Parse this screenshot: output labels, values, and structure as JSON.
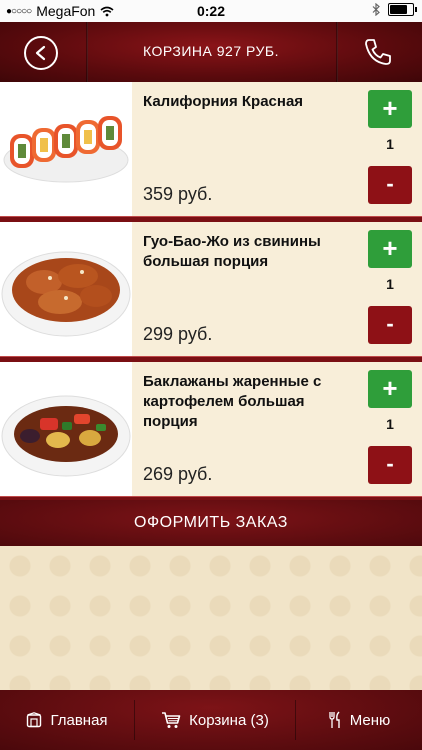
{
  "status_bar": {
    "carrier": "MegaFon",
    "time": "0:22",
    "battery_level": 0.85
  },
  "header": {
    "title": "КОРЗИНА 927 РУБ."
  },
  "cart_items": [
    {
      "name": "Калифорния Красная",
      "price": "359 руб.",
      "quantity": "1",
      "plus_label": "+",
      "minus_label": "-"
    },
    {
      "name": "Гуо-Бао-Жо из свинины большая порция",
      "price": "299 руб.",
      "quantity": "1",
      "plus_label": "+",
      "minus_label": "-"
    },
    {
      "name": "Баклажаны жаренные с картофелем большая порция",
      "price": "269 руб.",
      "quantity": "1",
      "plus_label": "+",
      "minus_label": "-"
    }
  ],
  "order_button": {
    "label": "ОФОРМИТЬ ЗАКАЗ"
  },
  "tab_bar": {
    "items": [
      {
        "label": "Главная",
        "icon": "home-icon"
      },
      {
        "label": "Корзина (3)",
        "icon": "cart-icon"
      },
      {
        "label": "Меню",
        "icon": "cutlery-icon"
      }
    ]
  },
  "colors": {
    "header_bg": "#5a0a0d",
    "plus_green": "#2f9e3a",
    "minus_red": "#8e1116",
    "page_bg": "#f3e8d2"
  }
}
